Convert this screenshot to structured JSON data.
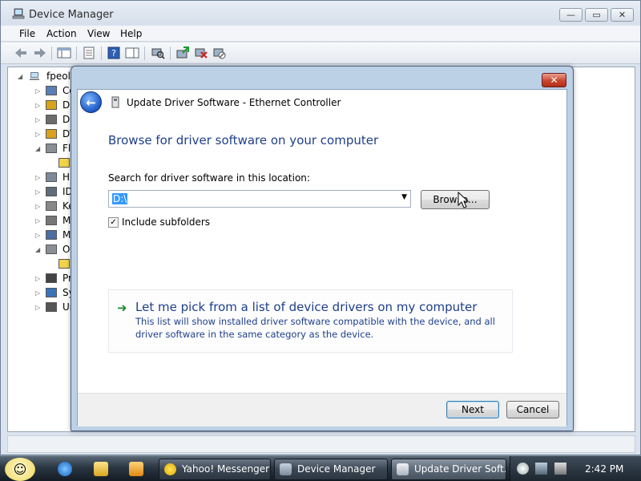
{
  "device_manager": {
    "title": "Device Manager",
    "menu": [
      "File",
      "Action",
      "View",
      "Help"
    ],
    "tree": {
      "root": "fpeoli",
      "items": [
        {
          "label": "Co",
          "expanded": false
        },
        {
          "label": "Di",
          "expanded": false
        },
        {
          "label": "Di",
          "expanded": false
        },
        {
          "label": "DV",
          "expanded": false
        },
        {
          "label": "Fl",
          "expanded": true
        },
        {
          "label": "",
          "expanded": false,
          "child": true
        },
        {
          "label": "Hu",
          "expanded": false
        },
        {
          "label": "ID",
          "expanded": false
        },
        {
          "label": "Ke",
          "expanded": false
        },
        {
          "label": "M",
          "expanded": false
        },
        {
          "label": "M",
          "expanded": false
        },
        {
          "label": "Ot",
          "expanded": true
        },
        {
          "label": "",
          "expanded": false,
          "child": true
        },
        {
          "label": "Pr",
          "expanded": false
        },
        {
          "label": "Sy",
          "expanded": false
        },
        {
          "label": "Ur",
          "expanded": false
        }
      ]
    }
  },
  "dialog": {
    "title": "Update Driver Software - Ethernet Controller",
    "close_glyph": "✕",
    "heading": "Browse for driver software on your computer",
    "search_label": "Search for driver software in this location:",
    "path_value": "D:\\",
    "browse_label": "Browse...",
    "include_subfolders_label": "Include subfolders",
    "include_subfolders_checked": true,
    "pick_title": "Let me pick from a list of device drivers on my computer",
    "pick_desc": "This list will show installed driver software compatible with the device, and all driver software in the same category as the device.",
    "next_label": "Next",
    "cancel_label": "Cancel"
  },
  "taskbar": {
    "tasks": [
      {
        "label": "Yahoo! Messenger",
        "icon": "yahoo-messenger-icon"
      },
      {
        "label": "Device Manager",
        "icon": "device-manager-icon"
      },
      {
        "label": "Update Driver Soft...",
        "icon": "update-driver-icon",
        "active": true
      }
    ],
    "clock": "2:42 PM"
  },
  "colors": {
    "link_blue": "#1e3f8b",
    "selection": "#3399ff",
    "close_red": "#c9452e"
  }
}
